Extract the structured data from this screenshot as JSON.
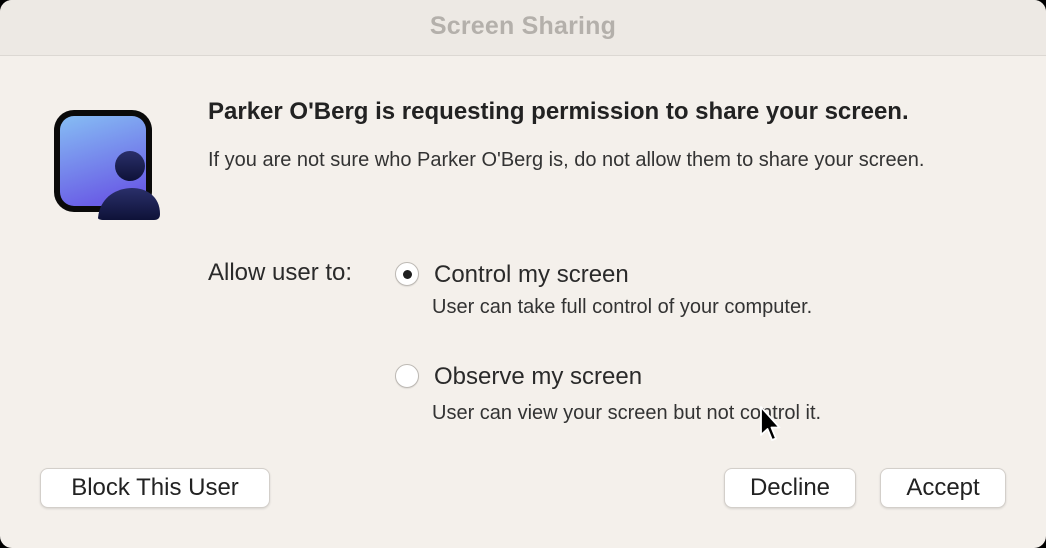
{
  "window": {
    "title": "Screen Sharing"
  },
  "icon": {
    "name": "screen-sharing-app-icon"
  },
  "message": {
    "heading": "Parker O'Berg is requesting permission to share your screen.",
    "subtext": "If you are not sure who Parker O'Berg is, do not allow them to share your screen."
  },
  "options": {
    "label": "Allow user to:",
    "items": [
      {
        "label": "Control my screen",
        "description": "User can take full control of your computer.",
        "selected": true
      },
      {
        "label": "Observe my screen",
        "description": "User can view your screen but not control it.",
        "selected": false
      }
    ]
  },
  "buttons": {
    "block": "Block This User",
    "decline": "Decline",
    "accept": "Accept"
  },
  "colors": {
    "background": "#f4f0eb",
    "icon_gradient_top": "#7fb6f2",
    "icon_gradient_bottom": "#6b63e6"
  }
}
